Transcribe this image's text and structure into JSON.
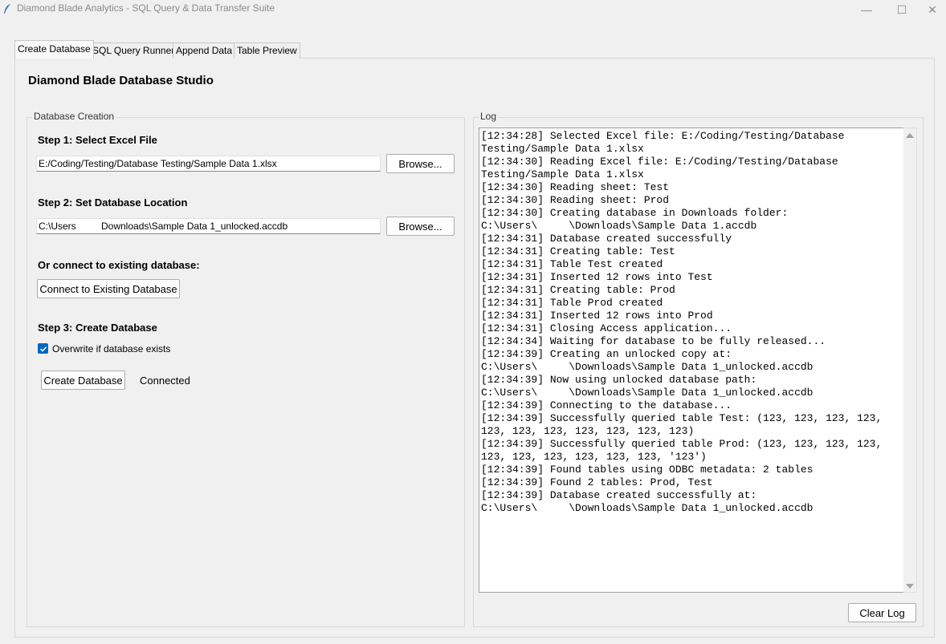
{
  "window": {
    "title": "Diamond Blade Analytics - SQL Query & Data Transfer Suite",
    "minimize": "—",
    "maximize": "☐",
    "close": "✕"
  },
  "tabs": [
    {
      "label": "Create Database",
      "active": true
    },
    {
      "label": "SQL Query Runner",
      "active": false
    },
    {
      "label": "Append Data",
      "active": false
    },
    {
      "label": "Table Preview",
      "active": false
    }
  ],
  "heading": "Diamond Blade Database Studio",
  "creation": {
    "group_label": "Database Creation",
    "step1_label": "Step 1: Select Excel File",
    "excel_path": "E:/Coding/Testing/Database Testing/Sample Data 1.xlsx",
    "browse_label": "Browse...",
    "step2_label": "Step 2: Set Database Location",
    "db_path_start": "C:\\Users",
    "db_path_end": "Downloads\\Sample Data 1_unlocked.accdb",
    "connect_heading": "Or connect to existing database:",
    "connect_button": "Connect to Existing Database",
    "step3_label": "Step 3: Create Database",
    "overwrite_label": "Overwrite if database exists",
    "overwrite_checked": true,
    "create_button": "Create Database",
    "status": "Connected"
  },
  "log": {
    "group_label": "Log",
    "clear_button": "Clear Log",
    "lines": [
      "[12:34:28] Selected Excel file: E:/Coding/Testing/Database",
      "Testing/Sample Data 1.xlsx",
      "[12:34:30] Reading Excel file: E:/Coding/Testing/Database",
      "Testing/Sample Data 1.xlsx",
      "[12:34:30] Reading sheet: Test",
      "[12:34:30] Reading sheet: Prod",
      "[12:34:30] Creating database in Downloads folder:",
      "C:\\Users\\     \\Downloads\\Sample Data 1.accdb",
      "[12:34:31] Database created successfully",
      "[12:34:31] Creating table: Test",
      "[12:34:31] Table Test created",
      "[12:34:31] Inserted 12 rows into Test",
      "[12:34:31] Creating table: Prod",
      "[12:34:31] Table Prod created",
      "[12:34:31] Inserted 12 rows into Prod",
      "[12:34:31] Closing Access application...",
      "[12:34:34] Waiting for database to be fully released...",
      "[12:34:39] Creating an unlocked copy at:",
      "C:\\Users\\     \\Downloads\\Sample Data 1_unlocked.accdb",
      "[12:34:39] Now using unlocked database path:",
      "C:\\Users\\     \\Downloads\\Sample Data 1_unlocked.accdb",
      "[12:34:39] Connecting to the database...",
      "[12:34:39] Successfully queried table Test: (123, 123, 123, 123,",
      "123, 123, 123, 123, 123, 123, 123)",
      "[12:34:39] Successfully queried table Prod: (123, 123, 123, 123,",
      "123, 123, 123, 123, 123, 123, '123')",
      "[12:34:39] Found tables using ODBC metadata: 2 tables",
      "[12:34:39] Found 2 tables: Prod, Test",
      "[12:34:39] Database created successfully at:",
      "C:\\Users\\     \\Downloads\\Sample Data 1_unlocked.accdb"
    ]
  },
  "colors": {
    "accent": "#0067c0",
    "background": "#f0f0f0"
  }
}
